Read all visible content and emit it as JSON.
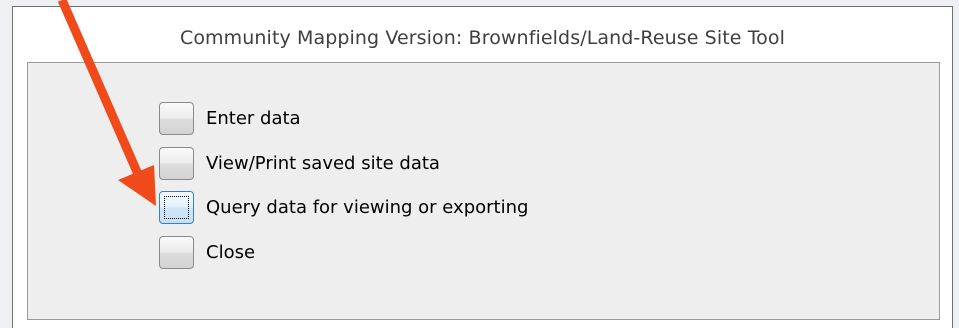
{
  "window": {
    "title": "Community Mapping Version: Brownfields/Land-Reuse Site Tool"
  },
  "menu": {
    "items": [
      {
        "label": "Enter data",
        "focused": false
      },
      {
        "label": "View/Print saved site data",
        "focused": false
      },
      {
        "label": "Query data for viewing or exporting",
        "focused": true
      },
      {
        "label": "Close",
        "focused": false
      }
    ]
  },
  "annotation": {
    "arrow_color": "#f04a1a",
    "points_to": "Query data for viewing or exporting"
  }
}
